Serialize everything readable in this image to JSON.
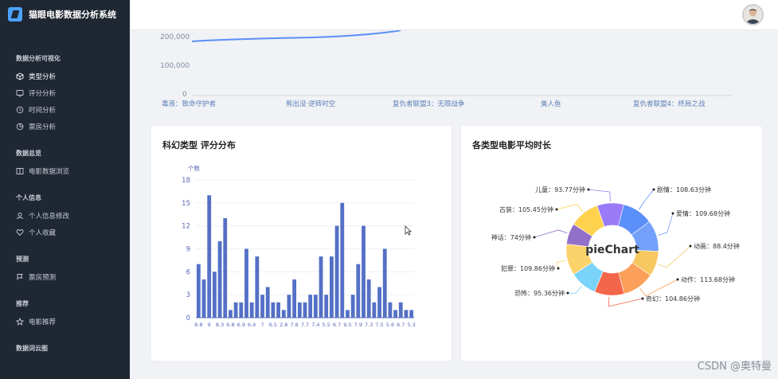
{
  "app": {
    "title": "猫眼电影数据分析系统"
  },
  "sidebar": {
    "groups": [
      {
        "label": "数据分析可视化",
        "items": [
          {
            "label": "类型分析",
            "icon": "cube-icon",
            "active": true
          },
          {
            "label": "评分分析",
            "icon": "monitor-icon"
          },
          {
            "label": "时间分析",
            "icon": "clock-icon"
          },
          {
            "label": "票房分析",
            "icon": "chart-icon"
          }
        ]
      },
      {
        "label": "数据总览",
        "items": [
          {
            "label": "电影数据浏览",
            "icon": "book-icon"
          }
        ]
      },
      {
        "label": "个人信息",
        "items": [
          {
            "label": "个人信息修改",
            "icon": "user-icon"
          },
          {
            "label": "个人收藏",
            "icon": "heart-icon"
          }
        ]
      },
      {
        "label": "预测",
        "items": [
          {
            "label": "票房预测",
            "icon": "flag-icon"
          }
        ]
      },
      {
        "label": "推荐",
        "items": [
          {
            "label": "电影推荐",
            "icon": "star-icon"
          }
        ]
      },
      {
        "label": "数据词云图",
        "items": []
      }
    ]
  },
  "top_chart": {
    "y_ticks": [
      "200,000",
      "100,000",
      "0"
    ],
    "x_ticks": [
      "毒液：致命守护者",
      "熊出没·逆转时空",
      "复仇者联盟3：无限战争",
      "美人鱼",
      "复仇者联盟4：终局之战"
    ]
  },
  "bar_card": {
    "title": "科幻类型 评分分布"
  },
  "pie_card": {
    "title": "各类型电影平均时长",
    "center_label": "pieChart"
  },
  "chart_data": [
    {
      "type": "bar",
      "title": "科幻类型 评分分布",
      "ylabel": "个数",
      "ylim": [
        0,
        18
      ],
      "y_ticks": [
        0,
        3,
        6,
        9,
        12,
        15,
        18
      ],
      "x_tick_labels": [
        "8.8",
        "9",
        "8.3",
        "6.8",
        "6.9",
        "6.4",
        "7",
        "6.5",
        "2.8",
        "7.8",
        "7.7",
        "7.4",
        "5.5",
        "6.7",
        "9.5",
        "7.9",
        "7.3",
        "7.5",
        "5.6",
        "6.7",
        "5.3"
      ],
      "values": [
        7,
        5,
        16,
        6,
        10,
        13,
        1,
        2,
        2,
        9,
        2,
        8,
        3,
        4,
        2,
        2,
        1,
        3,
        5,
        2,
        2,
        3,
        3,
        8,
        3,
        8,
        12,
        15,
        1,
        3,
        7,
        12,
        5,
        2,
        4,
        9,
        2,
        1,
        2,
        1,
        1
      ],
      "color": "#5470c6"
    },
    {
      "type": "pie",
      "title": "各类型电影平均时长",
      "slices": [
        {
          "name": "剧情",
          "label": "剧情：108.63分钟",
          "value": 108.63,
          "color": "#5b8ff9"
        },
        {
          "name": "爱情",
          "label": "爱情：109.68分钟",
          "value": 109.68,
          "color": "#73a0fa"
        },
        {
          "name": "动画",
          "label": "动画：88.4分钟",
          "value": 88.4,
          "color": "#f6c85f"
        },
        {
          "name": "动作",
          "label": "动作：113.68分钟",
          "value": 113.68,
          "color": "#fb9f5a"
        },
        {
          "name": "奇幻",
          "label": "奇幻：104.86分钟",
          "value": 104.86,
          "color": "#f4664a"
        },
        {
          "name": "恐怖",
          "label": "恐怖：95.36分钟",
          "value": 95.36,
          "color": "#7ad3f9"
        },
        {
          "name": "犯罪",
          "label": "犯罪：109.86分钟",
          "value": 109.86,
          "color": "#fcd36a"
        },
        {
          "name": "神话",
          "label": "神话：74分钟",
          "value": 74,
          "color": "#9270ca"
        },
        {
          "name": "古装",
          "label": "古装：105.45分钟",
          "value": 105.45,
          "color": "#ffd24d"
        },
        {
          "name": "儿童",
          "label": "儿童：93.77分钟",
          "value": 93.77,
          "color": "#9a7bf7"
        }
      ]
    }
  ],
  "watermark": "CSDN @奥特曼",
  "colors": {
    "sidebar_bg": "#1f2733",
    "accent": "#4aa3ff",
    "bar": "#5470c6",
    "line": "#5b8ff9"
  }
}
